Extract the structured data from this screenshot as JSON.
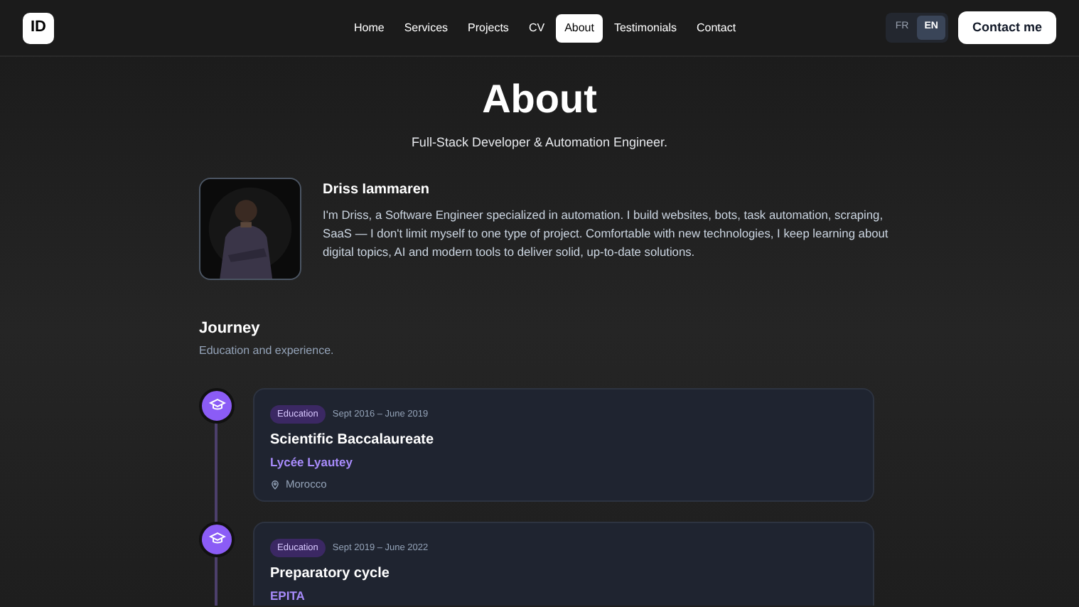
{
  "logo": "ID",
  "nav": [
    {
      "label": "Home",
      "selected": false
    },
    {
      "label": "Services",
      "selected": false
    },
    {
      "label": "Projects",
      "selected": false
    },
    {
      "label": "CV",
      "selected": false
    },
    {
      "label": "About",
      "selected": true
    },
    {
      "label": "Testimonials",
      "selected": false
    },
    {
      "label": "Contact",
      "selected": false
    }
  ],
  "languages": [
    {
      "label": "FR",
      "selected": false
    },
    {
      "label": "EN",
      "selected": true
    }
  ],
  "contact_button": "Contact me",
  "title": "About",
  "subtitle": "Full-Stack Developer & Automation Engineer.",
  "profile": {
    "name": "Driss Iammaren",
    "bio": "I'm Driss, a Software Engineer specialized in automation. I build websites, bots, task automation, scraping, SaaS — I don't limit myself to one type of project. Comfortable with new technologies, I keep learning about digital topics, AI and modern tools to deliver solid, up-to-date solutions."
  },
  "journey": {
    "title": "Journey",
    "subtitle": "Education and experience.",
    "entries": [
      {
        "tag": "Education",
        "dates": "Sept 2016 – June 2019",
        "title": "Scientific Baccalaureate",
        "school": "Lycée Lyautey",
        "location": "Morocco"
      },
      {
        "tag": "Education",
        "dates": "Sept 2019 – June 2022",
        "title": "Preparatory cycle",
        "school": "EPITA"
      }
    ]
  }
}
